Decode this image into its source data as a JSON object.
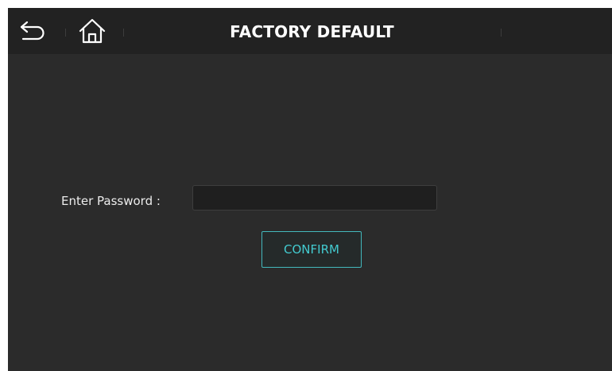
{
  "header": {
    "title": "FACTORY DEFAULT",
    "back_icon": "back-arrow-icon",
    "home_icon": "home-icon"
  },
  "form": {
    "password_label": "Enter Password :",
    "password_value": "",
    "password_placeholder": "",
    "confirm_label": "CONFIRM"
  },
  "colors": {
    "background": "#2b2b2b",
    "header_background": "#222222",
    "accent": "#43cbd0",
    "text": "#ffffff"
  }
}
